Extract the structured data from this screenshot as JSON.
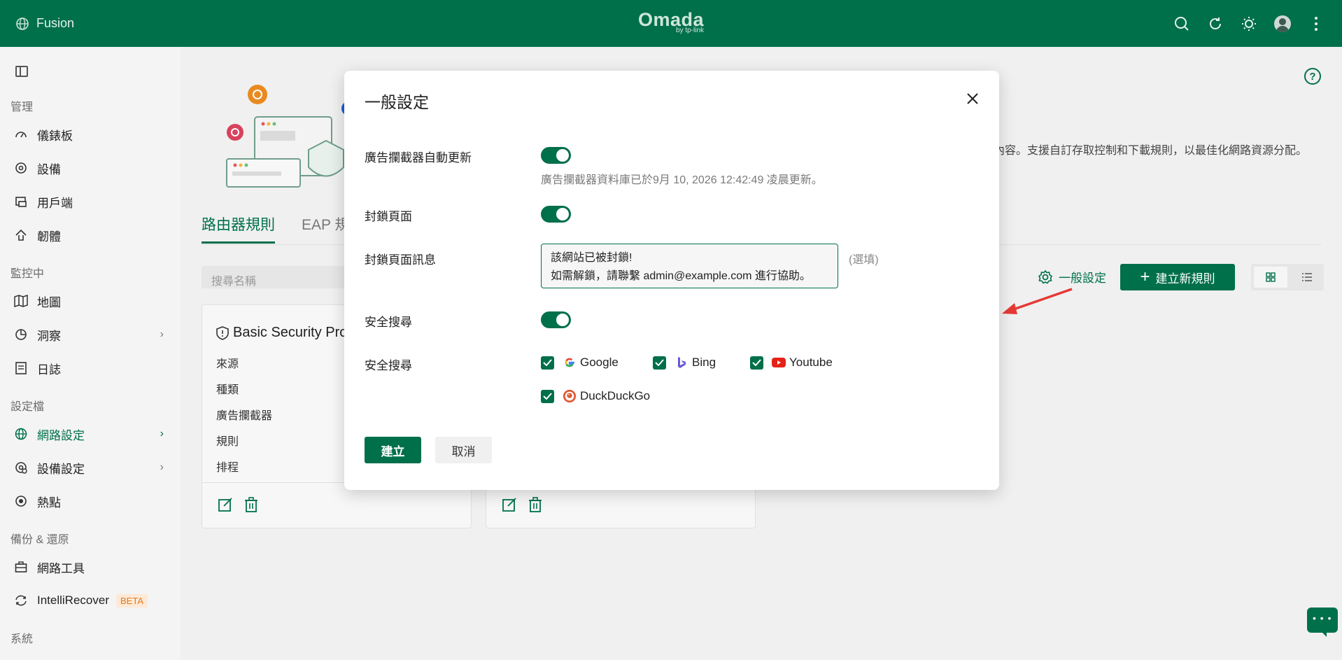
{
  "header": {
    "site_name": "Fusion",
    "logo": "Omada",
    "logo_sub": "by tp-link",
    "icons": [
      "search-icon",
      "refresh-icon",
      "theme-icon",
      "avatar",
      "more-icon"
    ]
  },
  "sidebar": {
    "sections": {
      "manage": "管理",
      "monitor": "監控中",
      "profiles": "設定檔",
      "backup": "備份 & 還原",
      "system": "系統"
    },
    "items": {
      "dashboard": "儀錶板",
      "devices": "設備",
      "clients": "用戶端",
      "firmware": "韌體",
      "map": "地圖",
      "insight": "洞察",
      "logs": "日誌",
      "network_config": "網路設定",
      "device_config": "設備設定",
      "hotspot": "熱點",
      "network_tools": "網路工具",
      "intellirecover": "IntelliRecover",
      "beta": "BETA"
    }
  },
  "content": {
    "description": "內容。支援自訂存取控制和下載規則，以最佳化網路資源分配。",
    "tabs": [
      "路由器規則",
      "EAP 規"
    ],
    "search_placeholder": "搜尋名稱",
    "general_settings": "一般設定",
    "create_rule": "建立新規則",
    "card": {
      "title": "Basic Security Pro",
      "rows": [
        "來源",
        "種類",
        "廣告攔截器",
        "規則",
        "排程"
      ]
    }
  },
  "modal": {
    "title": "一般設定",
    "adblock_auto_update_label": "廣告攔截器自動更新",
    "adblock_hint": "廣告攔截器資料庫已於9月 10, 2026 12:42:49 凌晨更新。",
    "block_page_label": "封鎖頁面",
    "block_page_message_label": "封鎖頁面訊息",
    "block_message_line1": "該網站已被封鎖!",
    "block_message_line2": "如需解鎖，請聯繫 admin@example.com 進行協助。",
    "optional": "(選填)",
    "safe_search_label": "安全搜尋",
    "safe_search_engines_label": "安全搜尋",
    "engines": {
      "google": "Google",
      "bing": "Bing",
      "youtube": "Youtube",
      "duckduckgo": "DuckDuckGo"
    },
    "create_button": "建立",
    "cancel_button": "取消"
  },
  "colors": {
    "primary": "#00704a",
    "annotation_arrow": "#e53935"
  }
}
